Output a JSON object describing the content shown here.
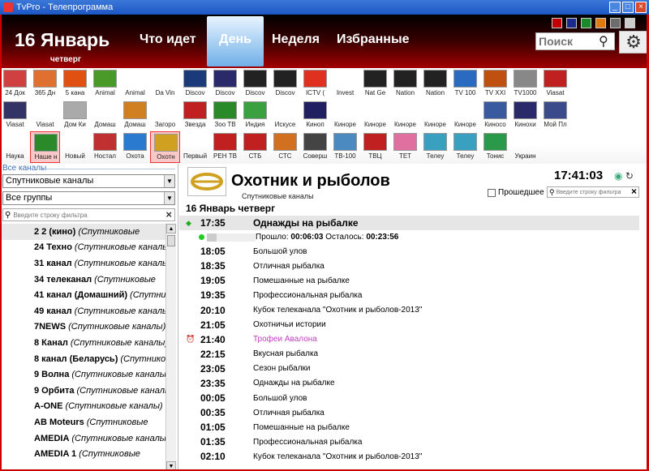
{
  "window": {
    "title": "TvPro - Телепрограмма"
  },
  "header": {
    "date": "16 Январь",
    "weekday": "четверг",
    "nav": [
      "Что идет",
      "День",
      "Неделя",
      "Избранные"
    ],
    "active_tab": "День",
    "search_placeholder": "Поиск",
    "swatches": [
      "#c00000",
      "#1b2a8a",
      "#1a8a2a",
      "#e07a10",
      "#6d6d6d",
      "#cccccc"
    ]
  },
  "channels_row1": [
    {
      "label": "24 Док",
      "color": "#d04040"
    },
    {
      "label": "365 Дн",
      "color": "#e07030"
    },
    {
      "label": "5 кана",
      "color": "#e05010"
    },
    {
      "label": "Animal",
      "color": "#4a9a2a"
    },
    {
      "label": "Animal",
      "color": ""
    },
    {
      "label": "Da Vin",
      "color": ""
    },
    {
      "label": "Discov",
      "color": "#1a3a7a"
    },
    {
      "label": "Discov",
      "color": "#2a2a6a"
    },
    {
      "label": "Discov",
      "color": "#222222"
    },
    {
      "label": "Discov",
      "color": "#222222"
    },
    {
      "label": "ICTV (",
      "color": "#e03020"
    },
    {
      "label": "Invest",
      "color": ""
    },
    {
      "label": "Nat Ge",
      "color": "#222222"
    },
    {
      "label": "Nation",
      "color": "#222222"
    },
    {
      "label": "Nation",
      "color": "#222222"
    },
    {
      "label": "TV 100",
      "color": "#2a6ac0"
    },
    {
      "label": "TV XXI",
      "color": "#c05010"
    },
    {
      "label": "TV1000",
      "color": "#888888"
    },
    {
      "label": "Viasat",
      "color": "#c02020"
    }
  ],
  "channels_row2": [
    {
      "label": "Viasat",
      "color": "#333366"
    },
    {
      "label": "Viasat",
      "color": ""
    },
    {
      "label": "Дом Ки",
      "color": "#aaaaaa"
    },
    {
      "label": "Домаш",
      "color": ""
    },
    {
      "label": "Домаш",
      "color": "#d08020"
    },
    {
      "label": "Загоро",
      "color": ""
    },
    {
      "label": "Звезда",
      "color": "#c02020"
    },
    {
      "label": "Зоо ТВ",
      "color": "#2a8a2a"
    },
    {
      "label": "Индия",
      "color": "#3aa040"
    },
    {
      "label": "Искусе",
      "color": ""
    },
    {
      "label": "Киноп",
      "color": "#202060"
    },
    {
      "label": "Киноре",
      "color": ""
    },
    {
      "label": "Киноре",
      "color": ""
    },
    {
      "label": "Киноре",
      "color": ""
    },
    {
      "label": "Киноре",
      "color": ""
    },
    {
      "label": "Киноре",
      "color": ""
    },
    {
      "label": "Киносо",
      "color": "#3a5aa0"
    },
    {
      "label": "Кинохи",
      "color": "#2a2a6a"
    },
    {
      "label": "Мой Пл",
      "color": "#3a4a8a"
    }
  ],
  "channels_row3": [
    {
      "label": "Наука",
      "color": ""
    },
    {
      "label": "Наше н",
      "color": "#2a8a2a"
    },
    {
      "label": "Новый",
      "color": ""
    },
    {
      "label": "Ностал",
      "color": "#c03030"
    },
    {
      "label": "Охота",
      "color": "#2a7ad0"
    },
    {
      "label": "Охотн",
      "color": "#d0a020"
    },
    {
      "label": "Первый",
      "color": ""
    },
    {
      "label": "РЕН ТВ",
      "color": "#c02020"
    },
    {
      "label": "СТБ",
      "color": "#c02020"
    },
    {
      "label": "СТС",
      "color": "#d07020"
    },
    {
      "label": "Соверш",
      "color": "#444444"
    },
    {
      "label": "ТВ-100",
      "color": "#4a8ac0"
    },
    {
      "label": "ТВЦ",
      "color": "#c02020"
    },
    {
      "label": "ТЕТ",
      "color": "#e070a0"
    },
    {
      "label": "Телеу",
      "color": "#3aa0c0"
    },
    {
      "label": "Телеу",
      "color": "#3aa0c0"
    },
    {
      "label": "Тонис",
      "color": "#2a9a4a"
    },
    {
      "label": "Украин",
      "color": ""
    }
  ],
  "left": {
    "section_title": "Все каналы",
    "combo1": "Спутниковые каналы",
    "combo2": "Все группы",
    "filter_placeholder": "Введите строку фильтра",
    "list": [
      {
        "name": "2 2 (кино)",
        "group": "(Спутниковые",
        "sel": true
      },
      {
        "name": "24 Техно",
        "group": "(Спутниковые каналы)"
      },
      {
        "name": "31 канал",
        "group": "(Спутниковые каналы)"
      },
      {
        "name": "34 телеканал",
        "group": "(Спутниковые"
      },
      {
        "name": "41 канал (Домашний)",
        "group": "(Спутник"
      },
      {
        "name": "49 канал",
        "group": "(Спутниковые каналы)"
      },
      {
        "name": "7NEWS",
        "group": "(Спутниковые каналы)"
      },
      {
        "name": "8 Канал",
        "group": "(Спутниковые каналы)"
      },
      {
        "name": "8 канал (Беларусь)",
        "group": "(Спутниковые"
      },
      {
        "name": "9 Волна",
        "group": "(Спутниковые каналы)"
      },
      {
        "name": "9 Орбита",
        "group": "(Спутниковые каналы)"
      },
      {
        "name": "A-ONE",
        "group": "(Спутниковые каналы)"
      },
      {
        "name": "AB Moteurs",
        "group": "(Спутниковые"
      },
      {
        "name": "AMEDIA",
        "group": "(Спутниковые каналы)"
      },
      {
        "name": "AMEDIA 1",
        "group": "(Спутниковые"
      }
    ]
  },
  "right": {
    "channel_title": "Охотник и рыболов",
    "channel_group": "Спутниковые каналы",
    "clock": "17:41:03",
    "past_label": "Прошедшее",
    "filter_placeholder": "Введите строку фильтра",
    "day_header": "16 Январь четверг",
    "current": {
      "time": "17:35",
      "title": "Однажды на рыбалке"
    },
    "progress": {
      "past_label": "Прошло:",
      "past": "00:06:03",
      "left_label": "Осталось:",
      "left": "00:23:56",
      "fraction": 0.2
    },
    "programs": [
      {
        "time": "18:05",
        "title": "Большой улов"
      },
      {
        "time": "18:35",
        "title": "Отличная рыбалка"
      },
      {
        "time": "19:05",
        "title": "Помешанные на рыбалке"
      },
      {
        "time": "19:35",
        "title": "Профессиональная рыбалка"
      },
      {
        "time": "20:10",
        "title": "Кубок телеканала \"Охотник и рыболов-2013\""
      },
      {
        "time": "21:05",
        "title": "Охотничьи истории"
      },
      {
        "time": "21:40",
        "title": "Трофеи Авалона",
        "highlight": true
      },
      {
        "time": "22:15",
        "title": "Вкусная рыбалка"
      },
      {
        "time": "23:05",
        "title": "Сезон рыбалки"
      },
      {
        "time": "23:35",
        "title": "Однажды на рыбалке"
      },
      {
        "time": "00:05",
        "title": "Большой улов"
      },
      {
        "time": "00:35",
        "title": "Отличная рыбалка"
      },
      {
        "time": "01:05",
        "title": "Помешанные на рыбалке"
      },
      {
        "time": "01:35",
        "title": "Профессиональная рыбалка"
      },
      {
        "time": "02:10",
        "title": "Кубок телеканала \"Охотник и рыболов-2013\""
      }
    ]
  }
}
